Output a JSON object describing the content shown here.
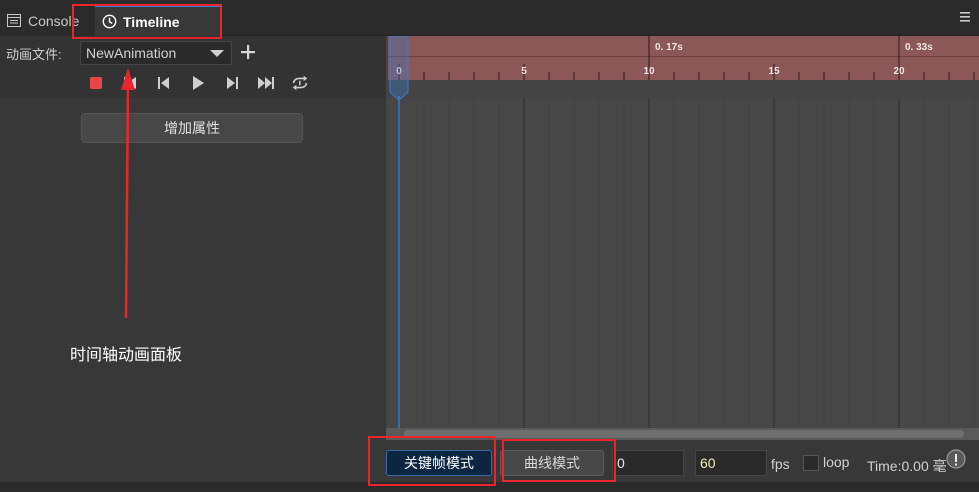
{
  "tabs": [
    {
      "label": "Console",
      "icon": "console-icon",
      "active": false
    },
    {
      "label": "Timeline",
      "icon": "clock-icon",
      "active": true
    }
  ],
  "toolbar": {
    "file_label": "动画文件:",
    "file_value": "NewAnimation",
    "add_property_label": "增加属性"
  },
  "annotation": {
    "text": "时间轴动画面板"
  },
  "ruler": {
    "time_labels": [
      {
        "frame": 10,
        "text": "0. 17s"
      },
      {
        "frame": 20,
        "text": "0. 33s"
      }
    ],
    "frame_labels": [
      "0",
      "5",
      "10",
      "15",
      "20"
    ],
    "playhead_frame": 0
  },
  "bottom": {
    "keyframe_mode_label": "关键帧模式",
    "curve_mode_label": "曲线模式",
    "frame_value": "0",
    "fps_value": "60",
    "fps_label": "fps",
    "loop_label": "loop",
    "loop_checked": false,
    "time_label": "Time:0.00 毫"
  },
  "colors": {
    "ruler": "#8c5757",
    "playhead": "#3a7bd5",
    "record": "#e84545",
    "annotation_red": "#e8262b",
    "keyframe_button": "#0c2540"
  }
}
